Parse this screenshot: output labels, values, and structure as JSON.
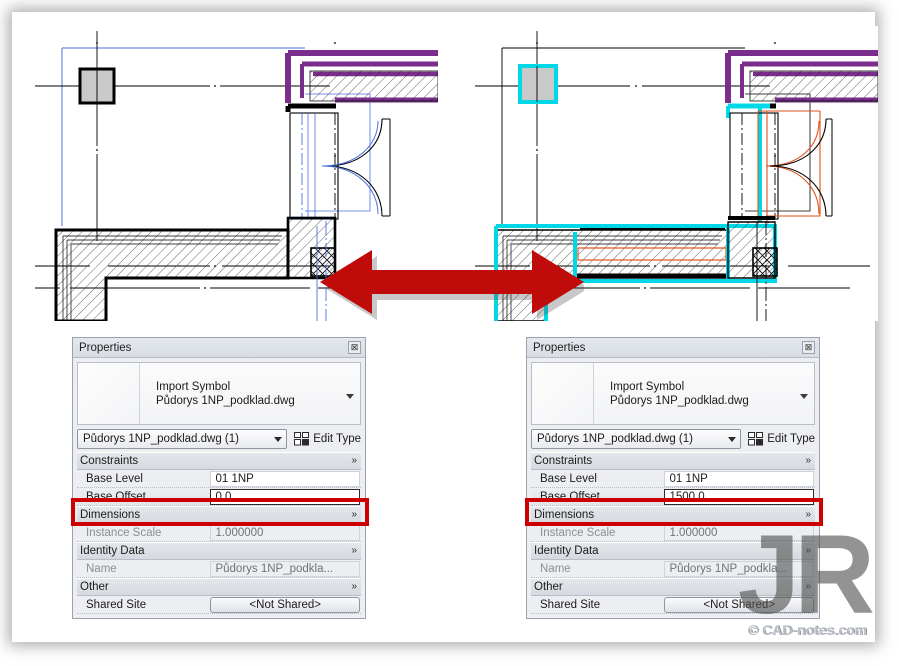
{
  "watermark": {
    "logo": "JR",
    "url": "© CAD-notes.com"
  },
  "arrow": {
    "name": "double-headed-red-arrow",
    "color": "#cc0000",
    "direction": "both"
  },
  "drawings": {
    "left": {
      "label": "cad-plan-before",
      "selection_color": "none",
      "accent_colors": [
        "#7b2d8b",
        "#3a63d8",
        "#000000"
      ]
    },
    "right": {
      "label": "cad-plan-after",
      "selection_color": "#00d8e8",
      "accent_colors": [
        "#7b2d8b",
        "#e2521b",
        "#000000"
      ]
    }
  },
  "panels": [
    {
      "id": "left-properties",
      "title": "Properties",
      "close_glyph": "⊠",
      "preview": {
        "line1": "Import Symbol",
        "line2": "Půdorys 1NP_podklad.dwg"
      },
      "type_selector": {
        "value": "Půdorys 1NP_podklad.dwg (1)"
      },
      "edit_type_label": "Edit Type",
      "groups": [
        {
          "name": "Constraints",
          "collapse_glyph": "»",
          "rows": [
            {
              "name": "Base Level",
              "value": "01 1NP",
              "readonly": false,
              "button": false,
              "highlight": false
            },
            {
              "name": "Base Offset",
              "value": "0.0",
              "readonly": false,
              "button": false,
              "highlight": true
            }
          ]
        },
        {
          "name": "Dimensions",
          "collapse_glyph": "»",
          "rows": [
            {
              "name": "Instance Scale",
              "value": "1.000000",
              "readonly": true,
              "button": false,
              "highlight": false
            }
          ]
        },
        {
          "name": "Identity Data",
          "collapse_glyph": "»",
          "rows": [
            {
              "name": "Name",
              "value": "Půdorys 1NP_podkla...",
              "readonly": true,
              "button": false,
              "highlight": false
            }
          ]
        },
        {
          "name": "Other",
          "collapse_glyph": "»",
          "rows": [
            {
              "name": "Shared Site",
              "value": "<Not Shared>",
              "readonly": false,
              "button": true,
              "highlight": false
            }
          ]
        }
      ]
    },
    {
      "id": "right-properties",
      "title": "Properties",
      "close_glyph": "⊠",
      "preview": {
        "line1": "Import Symbol",
        "line2": "Půdorys 1NP_podklad.dwg"
      },
      "type_selector": {
        "value": "Půdorys 1NP_podklad.dwg (1)"
      },
      "edit_type_label": "Edit Type",
      "groups": [
        {
          "name": "Constraints",
          "collapse_glyph": "»",
          "rows": [
            {
              "name": "Base Level",
              "value": "01 1NP",
              "readonly": false,
              "button": false,
              "highlight": false
            },
            {
              "name": "Base Offset",
              "value": "1500.0",
              "readonly": false,
              "button": false,
              "highlight": true
            }
          ]
        },
        {
          "name": "Dimensions",
          "collapse_glyph": "»",
          "rows": [
            {
              "name": "Instance Scale",
              "value": "1.000000",
              "readonly": true,
              "button": false,
              "highlight": false
            }
          ]
        },
        {
          "name": "Identity Data",
          "collapse_glyph": "»",
          "rows": [
            {
              "name": "Name",
              "value": "Půdorys 1NP_podkla...",
              "readonly": true,
              "button": false,
              "highlight": false
            }
          ]
        },
        {
          "name": "Other",
          "collapse_glyph": "»",
          "rows": [
            {
              "name": "Shared Site",
              "value": "<Not Shared>",
              "readonly": false,
              "button": true,
              "highlight": false
            }
          ]
        }
      ]
    }
  ]
}
